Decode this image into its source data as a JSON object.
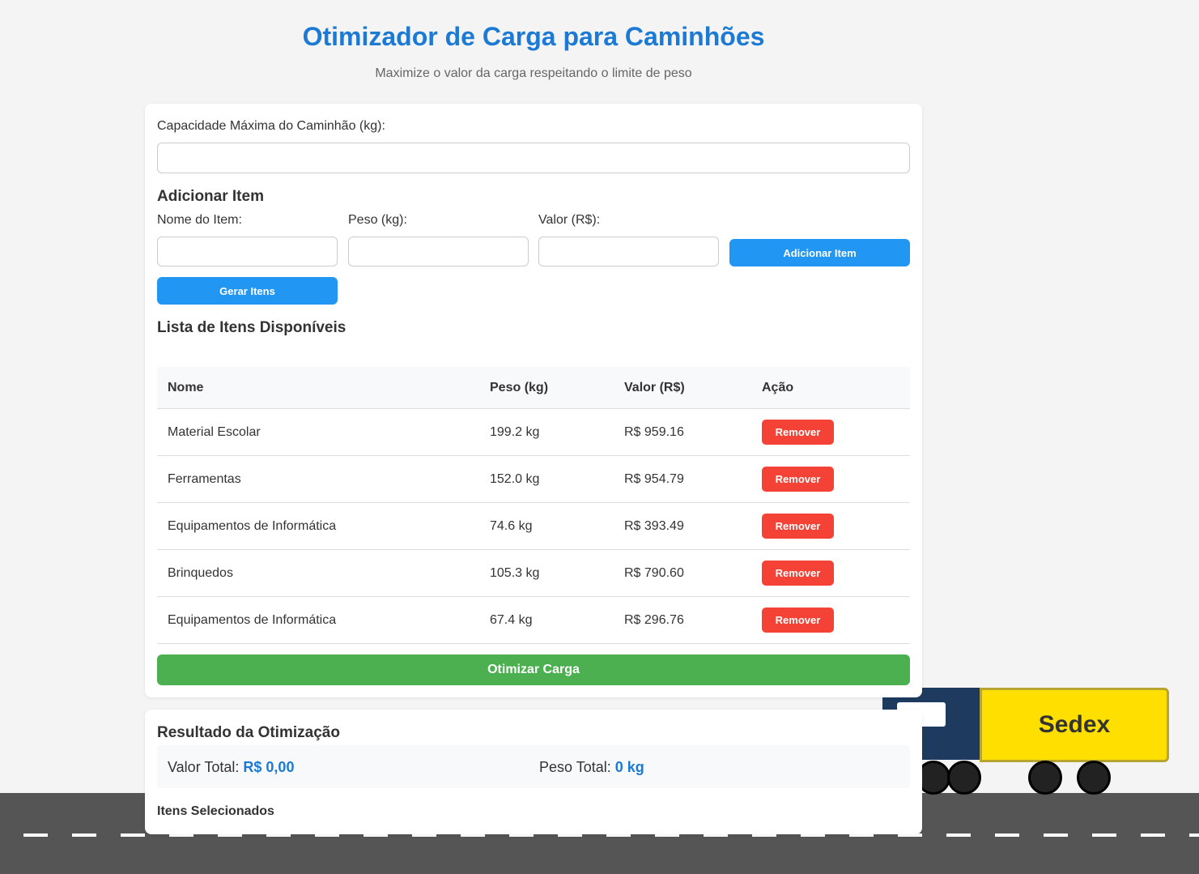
{
  "header": {
    "title": "Otimizador de Carga para Caminhões",
    "subtitle": "Maximize o valor da carga respeitando o limite de peso"
  },
  "capacity": {
    "label": "Capacidade Máxima do Caminhão (kg):",
    "value": ""
  },
  "add_item": {
    "heading": "Adicionar Item",
    "name_label": "Nome do Item:",
    "weight_label": "Peso (kg):",
    "value_label": "Valor (R$):",
    "add_button": "Adicionar Item",
    "generate_button": "Gerar Itens"
  },
  "items_list": {
    "heading": "Lista de Itens Disponíveis",
    "columns": [
      "Nome",
      "Peso (kg)",
      "Valor (R$)",
      "Ação"
    ],
    "rows": [
      {
        "name": "Material Escolar",
        "weight": "199.2 kg",
        "value": "R$ 959.16",
        "action": "Remover"
      },
      {
        "name": "Ferramentas",
        "weight": "152.0 kg",
        "value": "R$ 954.79",
        "action": "Remover"
      },
      {
        "name": "Equipamentos de Informática",
        "weight": "74.6 kg",
        "value": "R$ 393.49",
        "action": "Remover"
      },
      {
        "name": "Brinquedos",
        "weight": "105.3 kg",
        "value": "R$ 790.60",
        "action": "Remover"
      },
      {
        "name": "Equipamentos de Informática",
        "weight": "67.4 kg",
        "value": "R$ 296.76",
        "action": "Remover"
      }
    ],
    "optimize_button": "Otimizar Carga"
  },
  "result": {
    "heading": "Resultado da Otimização",
    "total_value_label": "Valor Total:",
    "total_value": "R$ 0,00",
    "total_weight_label": "Peso Total:",
    "total_weight": "0 kg",
    "selected_heading": "Itens Selecionados"
  },
  "truck": {
    "label": "Sedex",
    "cab_color": "#1e3a5f",
    "trailer_color": "#ffdf00"
  },
  "colors": {
    "accent": "#1c7ad4",
    "primary_button": "#2196f3",
    "danger_button": "#f44336",
    "success_button": "#4caf50",
    "road": "#555555"
  }
}
